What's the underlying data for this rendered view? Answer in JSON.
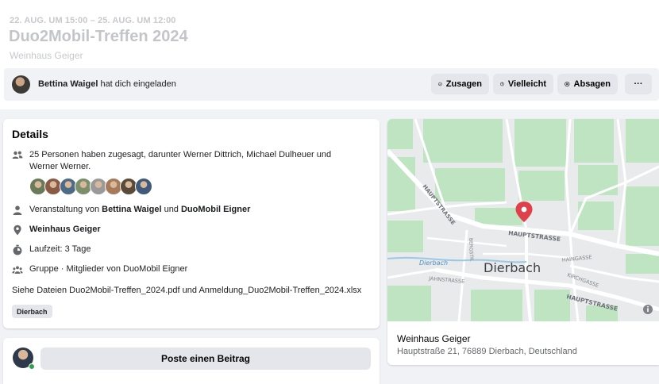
{
  "event": {
    "date_range": "22. AUG. UM 15:00 – 25. AUG. UM 12:00",
    "title": "Duo2Mobil-Treffen 2024",
    "venue": "Weinhaus Geiger"
  },
  "invite": {
    "inviter": "Bettina Waigel",
    "text": " hat dich eingeladen"
  },
  "rsvp": {
    "going": "Zusagen",
    "maybe": "Vielleicht",
    "decline": "Absagen",
    "more": "···"
  },
  "details": {
    "heading": "Details",
    "attending": "25 Personen haben zugesagt, darunter Werner Dittrich, Michael Dulheuer und Werner Werner.",
    "avatar_colors": [
      "#6b7b5a",
      "#8a5a44",
      "#4d6a86",
      "#7a8f6a",
      "#9a9a9a",
      "#a77a5a",
      "#5a4a3a",
      "#3f5a7a"
    ],
    "host_prefix": "Veranstaltung von ",
    "host_1": "Bettina Waigel",
    "host_join": " und ",
    "host_2": "DuoMobil Eigner",
    "place": "Weinhaus Geiger",
    "duration": "Laufzeit: 3 Tage",
    "group": "Gruppe · Mitglieder von DuoMobil Eigner",
    "files": "Siehe Dateien Duo2Mobil-Treffen_2024.pdf und Anmeldung_Duo2Mobil-Treffen_2024.xlsx",
    "tag": "Dierbach"
  },
  "post": {
    "button": "Poste einen Beitrag"
  },
  "map": {
    "town": "Dierbach",
    "street_main": "HAUPTSTRASSE",
    "street_left": "HAUPTSTRASSE",
    "street_lower": "HAUPTSTRASSE",
    "street_jahn": "JAHNSTRASSE",
    "street_haing": "HAINGASSE",
    "street_kirch": "KIRCHGASSE",
    "street_berg": "BERGSTR.",
    "creek": "Dierbach",
    "place_name": "Weinhaus Geiger",
    "address": "Hauptstraße 21, 76889 Dierbach, Deutschland",
    "pin_color": "#e0404a",
    "green": "#bfe4c2",
    "road": "#ffffff",
    "water": "#9bc8e6"
  }
}
